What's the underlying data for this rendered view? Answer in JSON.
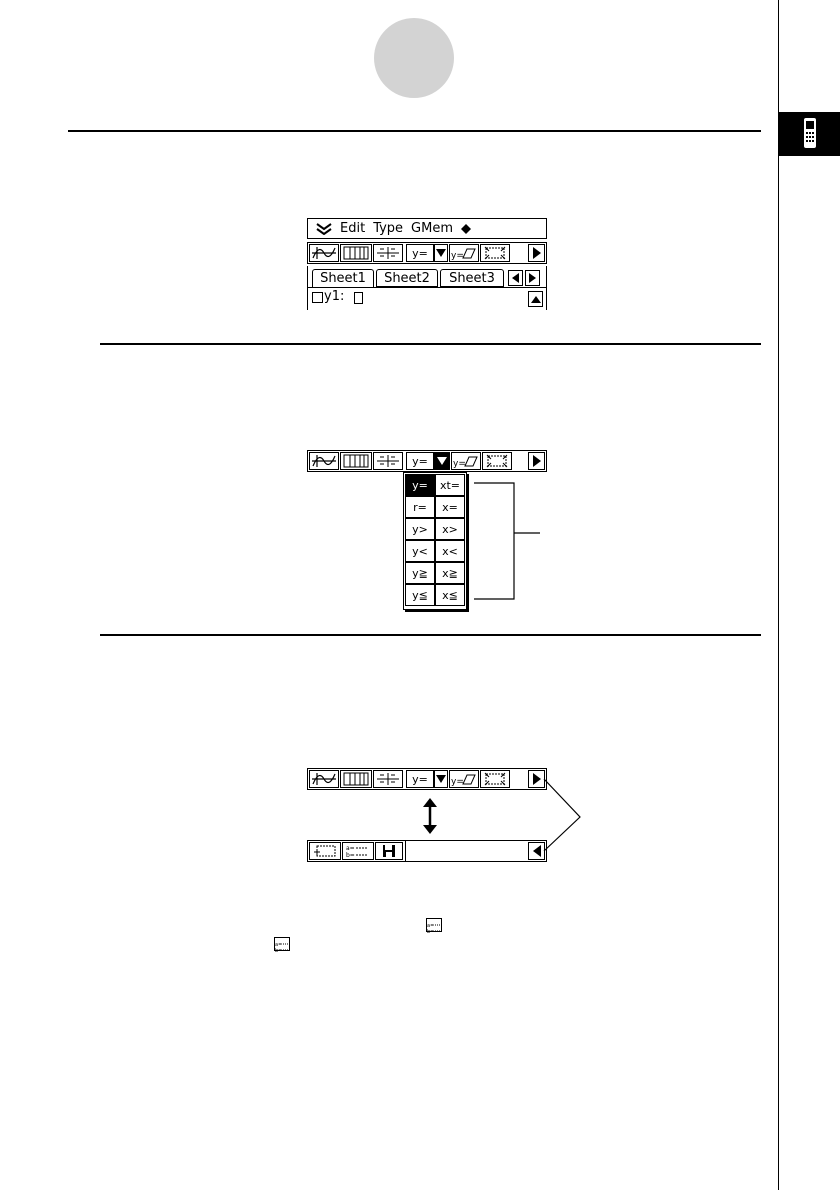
{
  "screen1": {
    "menu": {
      "menu_icon": "double-chevron-down-icon",
      "items": [
        "Edit",
        "Type",
        "GMem"
      ],
      "extra_icon": "diamond-icon"
    },
    "toolbar": {
      "buttons": [
        "graph-icon",
        "table-icon",
        "fraction-table-icon",
        "y=",
        "dropdown-arrow-icon",
        "y=graph-icon",
        "zoom-box-icon",
        "right-arrow-icon"
      ]
    },
    "tabs": [
      "Sheet1",
      "Sheet2",
      "Sheet3"
    ],
    "row_label": "y1:"
  },
  "screen2": {
    "y_label": "y=",
    "dropdown": {
      "left": [
        "y=",
        "r=",
        "y>",
        "y<",
        "y≧",
        "y≦"
      ],
      "right": [
        "xt=",
        "x=",
        "x>",
        "x<",
        "x≧",
        "x≦"
      ]
    }
  },
  "screen3": {
    "y_label": "y="
  }
}
